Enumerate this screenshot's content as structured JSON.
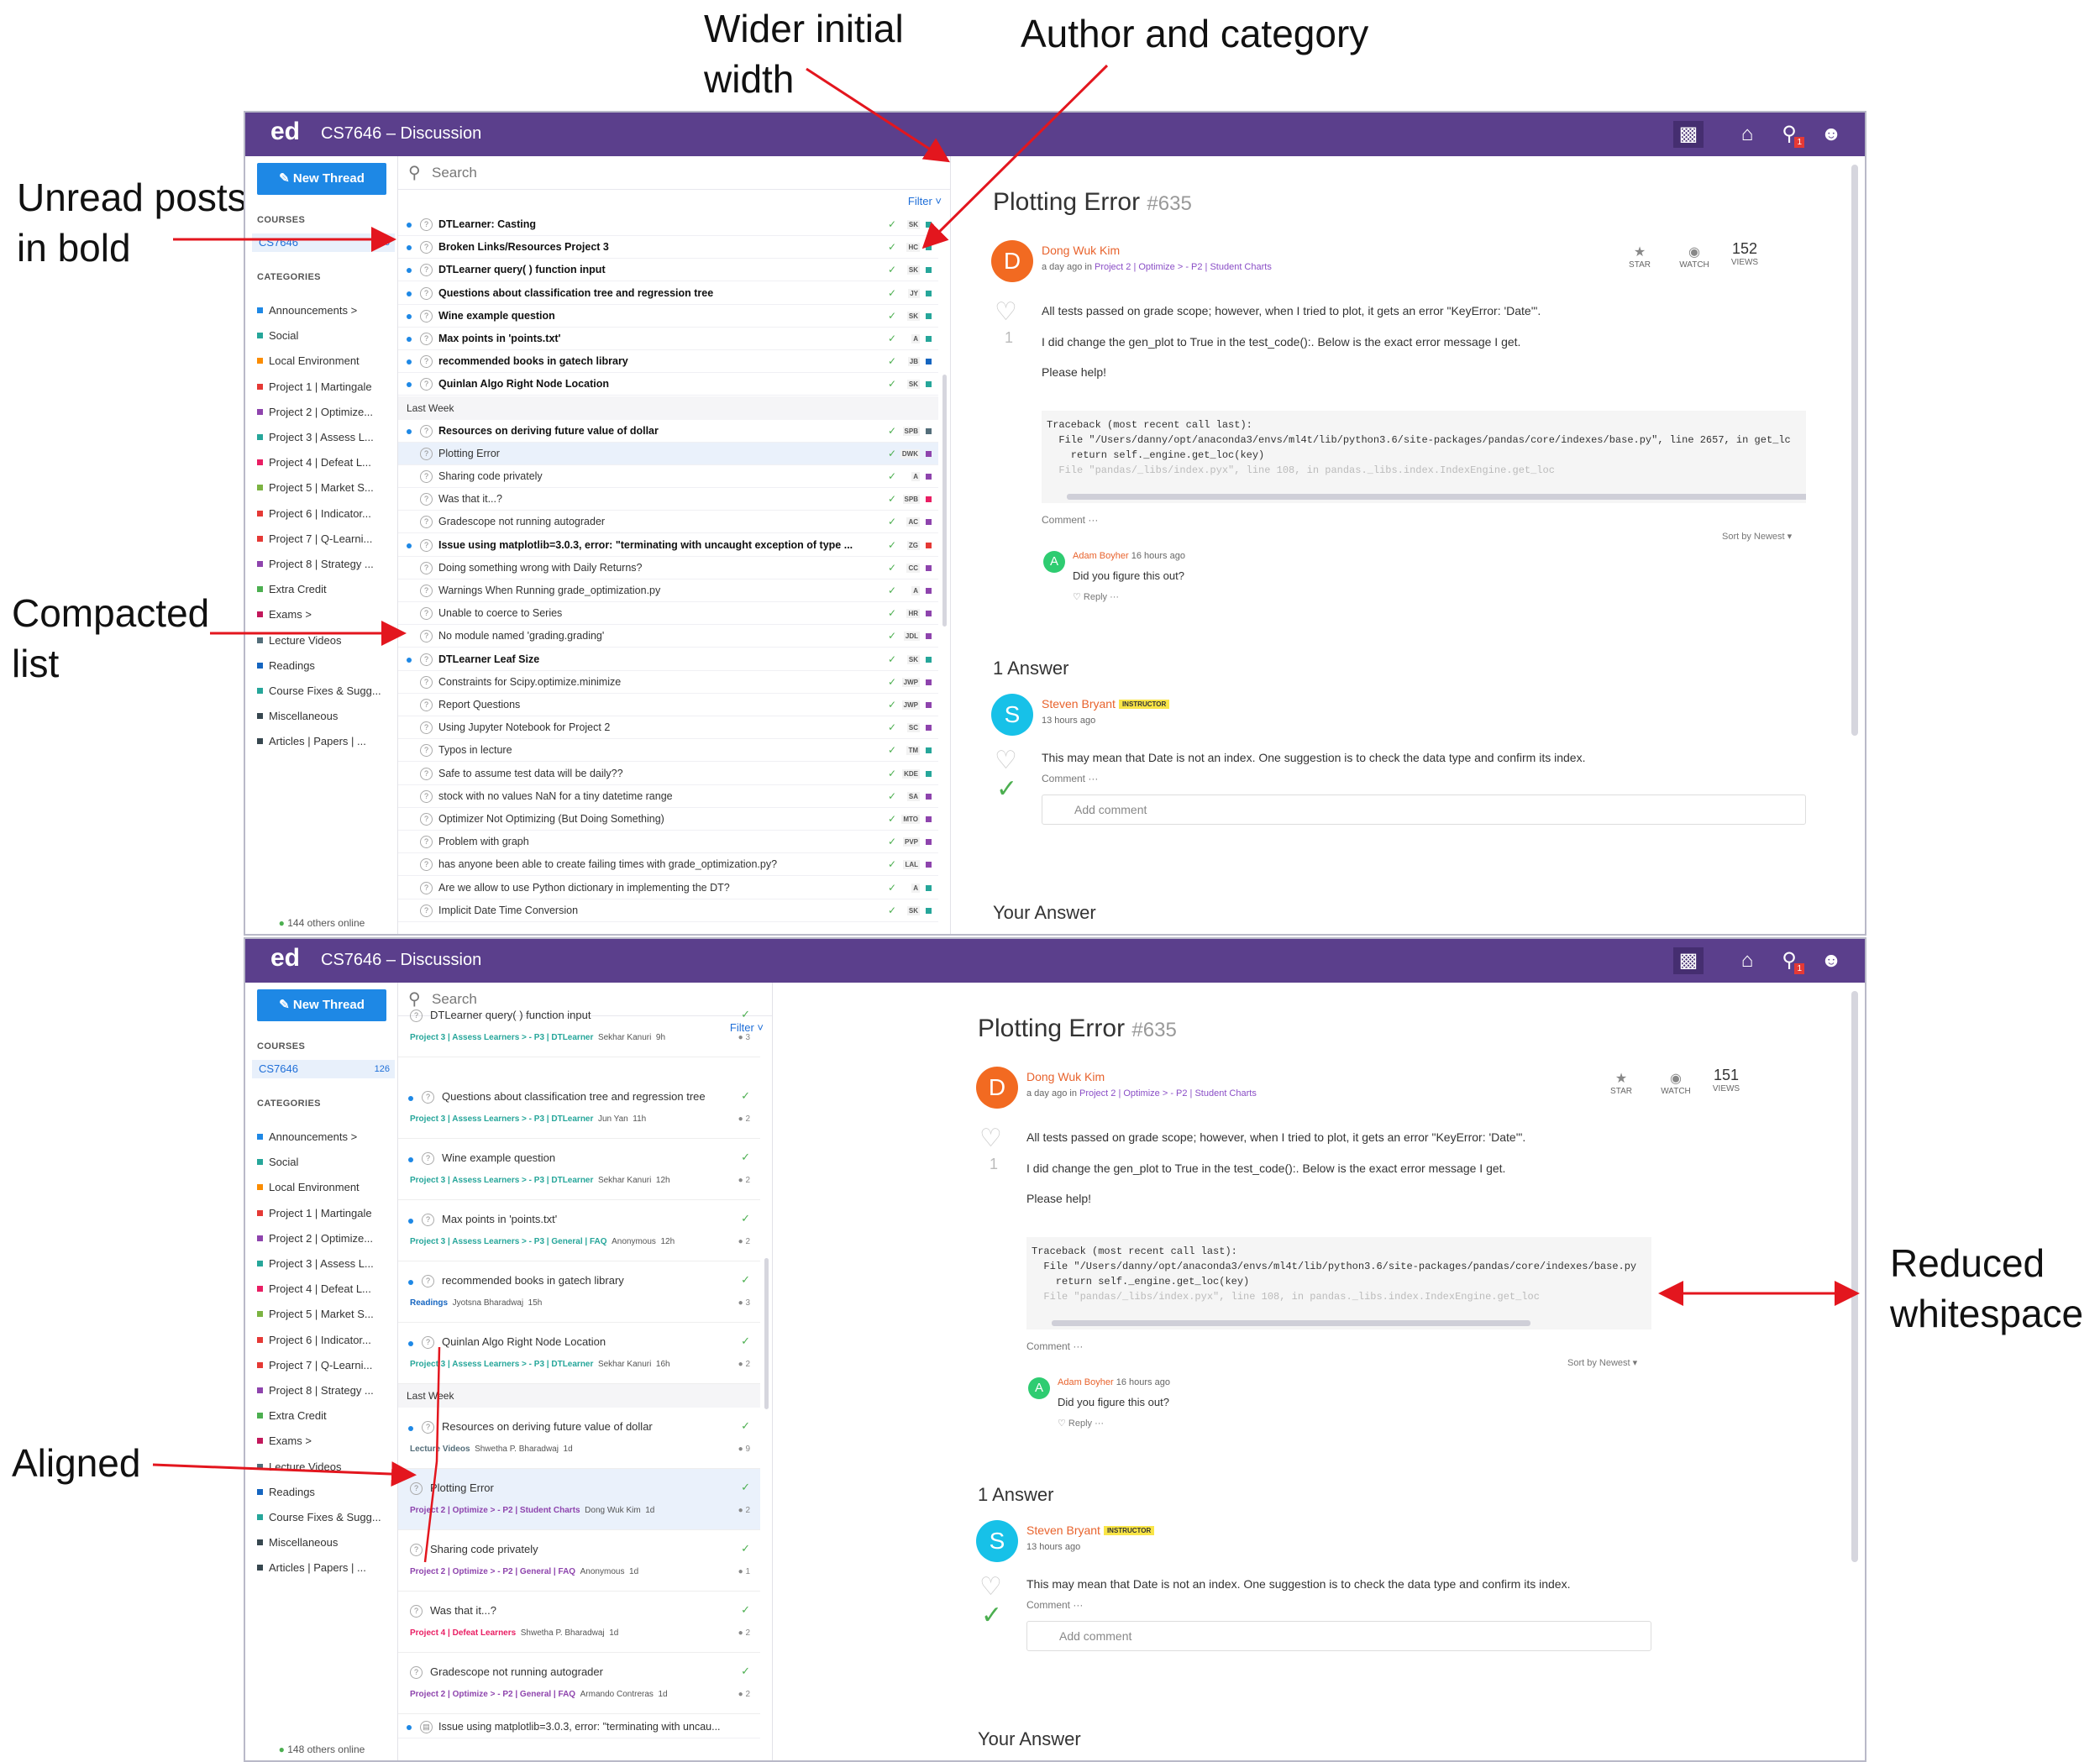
{
  "annotations": {
    "wider": "Wider initial\nwidth",
    "author": "Author and category",
    "unread": "Unread posts\nin bold",
    "compacted": "Compacted\nlist",
    "reduced": "Reduced\nwhitespace",
    "aligned": "Aligned"
  },
  "colors": {
    "brand": "#5b3f8c",
    "accent": "#1e88e5",
    "arrow": "#e3161e"
  },
  "header": {
    "logo": "ed",
    "title": "CS7646 – Discussion",
    "icons": [
      "chat-icon",
      "home-icon",
      "bell-icon",
      "user-icon"
    ],
    "bell_badge": "1"
  },
  "sidebar": {
    "new_thread": "New Thread",
    "courses_heading": "COURSES",
    "course": {
      "name": "CS7646",
      "count": "126"
    },
    "categories_heading": "CATEGORIES",
    "categories": [
      {
        "label": "Announcements >",
        "color": "#1e88e5"
      },
      {
        "label": "Social",
        "color": "#26a69a"
      },
      {
        "label": "Local Environment",
        "color": "#fb8c00"
      },
      {
        "label": "Project 1 | Martingale",
        "color": "#e53935"
      },
      {
        "label": "Project 2 | Optimize...",
        "color": "#8e44ad"
      },
      {
        "label": "Project 3 | Assess L...",
        "color": "#26a69a"
      },
      {
        "label": "Project 4 | Defeat L...",
        "color": "#e91e63"
      },
      {
        "label": "Project 5 | Market S...",
        "color": "#7cb342"
      },
      {
        "label": "Project 6 | Indicator...",
        "color": "#e53935"
      },
      {
        "label": "Project 7 | Q-Learni...",
        "color": "#e53935"
      },
      {
        "label": "Project 8 | Strategy ...",
        "color": "#8e44ad"
      },
      {
        "label": "Extra Credit",
        "color": "#4caf50"
      },
      {
        "label": "Exams >",
        "color": "#c2185b"
      },
      {
        "label": "Lecture Videos",
        "color": "#546e7a"
      },
      {
        "label": "Readings",
        "color": "#1565c0"
      },
      {
        "label": "Course Fixes & Sugg...",
        "color": "#26a69a"
      },
      {
        "label": "Miscellaneous",
        "color": "#37474f"
      },
      {
        "label": "Articles | Papers | ...",
        "color": "#37474f"
      }
    ],
    "online_top": "144 others online",
    "online_bottom": "148 others online"
  },
  "list": {
    "search_placeholder": "Search",
    "filter": "Filter",
    "last_week": "Last Week",
    "top_rows": [
      {
        "title": "DTLearner: Casting",
        "bold": true,
        "author": "SK",
        "color": "#26a69a"
      },
      {
        "title": "Broken Links/Resources Project 3",
        "bold": true,
        "author": "HC",
        "color": "#26a69a"
      },
      {
        "title": "DTLearner query( ) function input",
        "bold": true,
        "author": "SK",
        "color": "#26a69a"
      },
      {
        "title": "Questions about classification tree and regression tree",
        "bold": true,
        "author": "JY",
        "color": "#26a69a"
      },
      {
        "title": "Wine example question",
        "bold": true,
        "author": "SK",
        "color": "#26a69a"
      },
      {
        "title": "Max points in 'points.txt'",
        "bold": true,
        "author": "A",
        "color": "#26a69a"
      },
      {
        "title": "recommended books in gatech library",
        "bold": true,
        "author": "JB",
        "color": "#1565c0"
      },
      {
        "title": "Quinlan Algo Right Node Location",
        "bold": true,
        "author": "SK",
        "color": "#26a69a"
      },
      {
        "title": "Resources on deriving future value of dollar",
        "bold": true,
        "author": "SPB",
        "color": "#546e7a"
      },
      {
        "title": "Plotting Error",
        "bold": false,
        "author": "DWK",
        "color": "#8e44ad"
      },
      {
        "title": "Sharing code privately",
        "bold": false,
        "author": "A",
        "color": "#8e44ad"
      },
      {
        "title": "Was that it...?",
        "bold": false,
        "author": "SPB",
        "color": "#e91e63"
      },
      {
        "title": "Gradescope not running autograder",
        "bold": false,
        "author": "AC",
        "color": "#8e44ad"
      },
      {
        "title": "Issue using matplotlib=3.0.3, error: \"terminating with uncaught exception of type ...",
        "bold": true,
        "author": "ZG",
        "color": "#e53935"
      },
      {
        "title": "Doing something wrong with Daily Returns?",
        "bold": false,
        "author": "CC",
        "color": "#8e44ad"
      },
      {
        "title": "Warnings When Running grade_optimization.py",
        "bold": false,
        "author": "A",
        "color": "#8e44ad"
      },
      {
        "title": "Unable to coerce to Series",
        "bold": false,
        "author": "HR",
        "color": "#8e44ad"
      },
      {
        "title": "No module named 'grading.grading'",
        "bold": false,
        "author": "JDL",
        "color": "#8e44ad"
      },
      {
        "title": "DTLearner Leaf Size",
        "bold": true,
        "author": "SK",
        "color": "#26a69a"
      },
      {
        "title": "Constraints for Scipy.optimize.minimize",
        "bold": false,
        "author": "JWP",
        "color": "#8e44ad"
      },
      {
        "title": "Report Questions",
        "bold": false,
        "author": "JWP",
        "color": "#8e44ad"
      },
      {
        "title": "Using Jupyter Notebook for Project 2",
        "bold": false,
        "author": "SC",
        "color": "#8e44ad"
      },
      {
        "title": "Typos in lecture",
        "bold": false,
        "author": "TM",
        "color": "#26a69a"
      },
      {
        "title": "Safe to assume test data will be daily??",
        "bold": false,
        "author": "KDE",
        "color": "#26a69a"
      },
      {
        "title": "stock with no values NaN for a tiny datetime range",
        "bold": false,
        "author": "SA",
        "color": "#8e44ad"
      },
      {
        "title": "Optimizer Not Optimizing (But Doing Something)",
        "bold": false,
        "author": "MTO",
        "color": "#8e44ad"
      },
      {
        "title": "Problem with graph",
        "bold": false,
        "author": "PVP",
        "color": "#8e44ad"
      },
      {
        "title": "has anyone been able to create failing times with grade_optimization.py?",
        "bold": false,
        "author": "LAL",
        "color": "#8e44ad"
      },
      {
        "title": "Are we allow to use Python dictionary in implementing the DT?",
        "bold": false,
        "author": "A",
        "color": "#26a69a"
      },
      {
        "title": "Implicit Date Time Conversion",
        "bold": false,
        "author": "SK",
        "color": "#26a69a"
      }
    ],
    "bottom_rows": [
      {
        "title": "DTLearner query( ) function input",
        "cat": "Project 3 | Assess Learners > - P3 | DTLearner",
        "who": "Sekhar Kanuri",
        "when": "9h",
        "count": "3",
        "catcolor": "#26a69a",
        "dot": false
      },
      {
        "title": "Questions about classification tree and regression tree",
        "cat": "Project 3 | Assess Learners > - P3 | DTLearner",
        "who": "Jun Yan",
        "when": "11h",
        "count": "2",
        "catcolor": "#26a69a",
        "dot": true
      },
      {
        "title": "Wine example question",
        "cat": "Project 3 | Assess Learners > - P3 | DTLearner",
        "who": "Sekhar Kanuri",
        "when": "12h",
        "count": "2",
        "catcolor": "#26a69a",
        "dot": true
      },
      {
        "title": "Max points in 'points.txt'",
        "cat": "Project 3 | Assess Learners > - P3 | General | FAQ",
        "who": "Anonymous",
        "when": "12h",
        "count": "2",
        "catcolor": "#26a69a",
        "dot": true
      },
      {
        "title": "recommended books in gatech library",
        "cat": "Readings",
        "who": "Jyotsna Bharadwaj",
        "when": "15h",
        "count": "3",
        "catcolor": "#1565c0",
        "dot": true
      },
      {
        "title": "Quinlan Algo Right Node Location",
        "cat": "Project 3 | Assess Learners > - P3 | DTLearner",
        "who": "Sekhar Kanuri",
        "when": "16h",
        "count": "2",
        "catcolor": "#26a69a",
        "dot": true
      },
      {
        "title": "Resources on deriving future value of dollar",
        "cat": "Lecture Videos",
        "who": "Shwetha P. Bharadwaj",
        "when": "1d",
        "count": "9",
        "catcolor": "#546e7a",
        "dot": true
      },
      {
        "title": "Plotting Error",
        "cat": "Project 2 | Optimize > - P2 | Student Charts",
        "who": "Dong Wuk Kim",
        "when": "1d",
        "count": "2",
        "catcolor": "#8e44ad",
        "dot": false,
        "sel": true
      },
      {
        "title": "Sharing code privately",
        "cat": "Project 2 | Optimize > - P2 | General | FAQ",
        "who": "Anonymous",
        "when": "1d",
        "count": "1",
        "catcolor": "#8e44ad",
        "dot": false
      },
      {
        "title": "Was that it...?",
        "cat": "Project 4 | Defeat Learners",
        "who": "Shwetha P. Bharadwaj",
        "when": "1d",
        "count": "2",
        "catcolor": "#e91e63",
        "dot": false
      },
      {
        "title": "Gradescope not running autograder",
        "cat": "Project 2 | Optimize > - P2 | General | FAQ",
        "who": "Armando Contreras",
        "when": "1d",
        "count": "2",
        "catcolor": "#8e44ad",
        "dot": false
      }
    ],
    "bottom_last": "Issue using matplotlib=3.0.3, error: \"terminating with uncau..."
  },
  "post": {
    "title": "Plotting Error",
    "number": "#635",
    "author": "Dong Wuk Kim",
    "avatar": "D",
    "meta_prefix": "a day ago in",
    "meta_link": "Project 2 | Optimize > - P2 | Student Charts",
    "star": "STAR",
    "watch": "WATCH",
    "views_top": "152",
    "views_bottom": "151",
    "views": "VIEWS",
    "votes": "1",
    "p1": "All tests passed on grade scope; however, when I tried to plot, it gets an error \"KeyError: 'Date'\".",
    "p2": "I did change the gen_plot to True in the test_code():. Below is the exact error message I get.",
    "p3": "Please help!",
    "code1": "Traceback (most recent call last):",
    "code2": "  File \"/Users/danny/opt/anaconda3/envs/ml4t/lib/python3.6/site-packages/pandas/core/indexes/base.py\", line 2657, in get_lc",
    "code2b": "  File \"/Users/danny/opt/anaconda3/envs/ml4t/lib/python3.6/site-packages/pandas/core/indexes/base.py",
    "code3": "    return self._engine.get_loc(key)",
    "code4": "  File \"pandas/_libs/index.pyx\", line 108, in pandas._libs.index.IndexEngine.get_loc",
    "comment": "Comment",
    "sort": "Sort by Newest",
    "c_author": "Adam Boyher",
    "c_avatar": "A",
    "c_when": "16 hours ago",
    "c_text": "Did you figure this out?",
    "reply": "Reply",
    "answers": "1 Answer",
    "a_author": "Steven Bryant",
    "a_avatar": "S",
    "a_badge": "INSTRUCTOR",
    "a_when": "13 hours ago",
    "a_text": "This may mean that Date is not an index. One suggestion is to check the data type and confirm its index.",
    "add_comment": "Add comment",
    "your_answer": "Your Answer"
  }
}
